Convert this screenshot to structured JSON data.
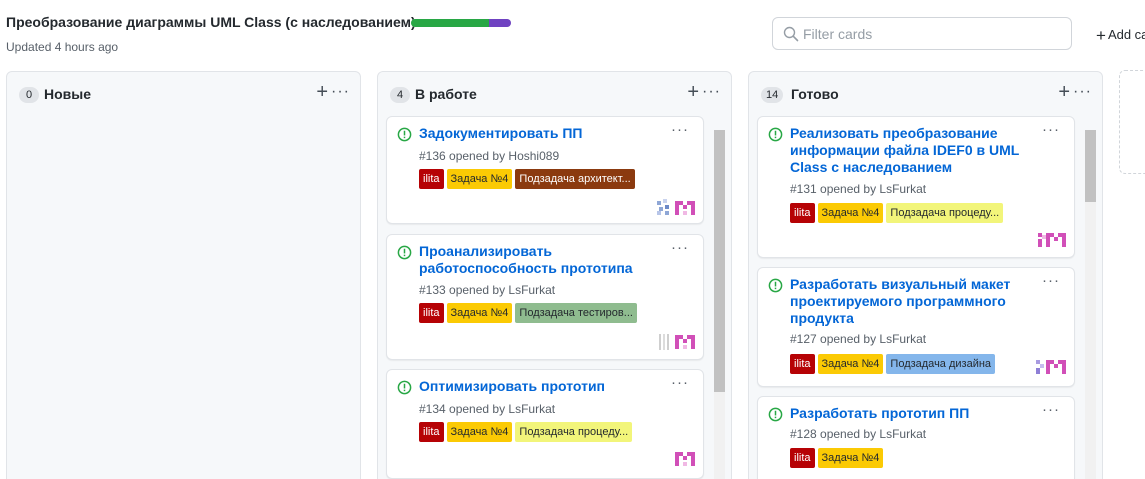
{
  "project": {
    "title": "Преобразование диаграммы UML Class (с наследованием)",
    "updated": "Updated 4 hours ago",
    "progress": {
      "done_fraction": 0.78,
      "in_progress_fraction": 0.22,
      "done_color": "#28a745",
      "in_progress_color": "#6f42c1"
    }
  },
  "filter": {
    "placeholder": "Filter cards",
    "value": "",
    "icon": "search-icon"
  },
  "add_column": {
    "label": "Add ca",
    "icon": "plus-icon"
  },
  "colors": {
    "ilita": "#b60205",
    "task": "#fbca04",
    "arch": "#8b3a0f",
    "test": "#8fbc8f",
    "proc": "#f2f57a",
    "design": "#84b6eb",
    "link": "#0366d6",
    "open_icon": "#28a745"
  },
  "columns": [
    {
      "count": "0",
      "name": "Новые",
      "cards": []
    },
    {
      "count": "4",
      "name": "В работе",
      "cards": [
        {
          "title": "Задокументировать ПП",
          "meta": "#136 opened by Hoshi089",
          "labels": [
            "ilita",
            "Задача №4",
            "Подзадача архитект..."
          ]
        },
        {
          "title": "Проанализировать работоспособность прототипа",
          "meta": "#133 opened by LsFurkat",
          "labels": [
            "ilita",
            "Задача №4",
            "Подзадача тестиров..."
          ]
        },
        {
          "title": "Оптимизировать прототип",
          "meta": "#134 opened by LsFurkat",
          "labels": [
            "ilita",
            "Задача №4",
            "Подзадача процеду..."
          ]
        }
      ]
    },
    {
      "count": "14",
      "name": "Готово",
      "cards": [
        {
          "title": "Реализовать преобразование информации файла IDEF0 в UML Class с наследованием",
          "meta": "#131 opened by LsFurkat",
          "labels": [
            "ilita",
            "Задача №4",
            "Подзадача процеду..."
          ]
        },
        {
          "title": "Разработать визуальный макет проектируемого программного продукта",
          "meta": "#127 opened by LsFurkat",
          "labels": [
            "ilita",
            "Задача №4",
            "Подзадача дизайна"
          ]
        },
        {
          "title": "Разработать прототип ПП",
          "meta": "#128 opened by LsFurkat",
          "labels": [
            "ilita",
            "Задача №4"
          ]
        }
      ]
    }
  ]
}
